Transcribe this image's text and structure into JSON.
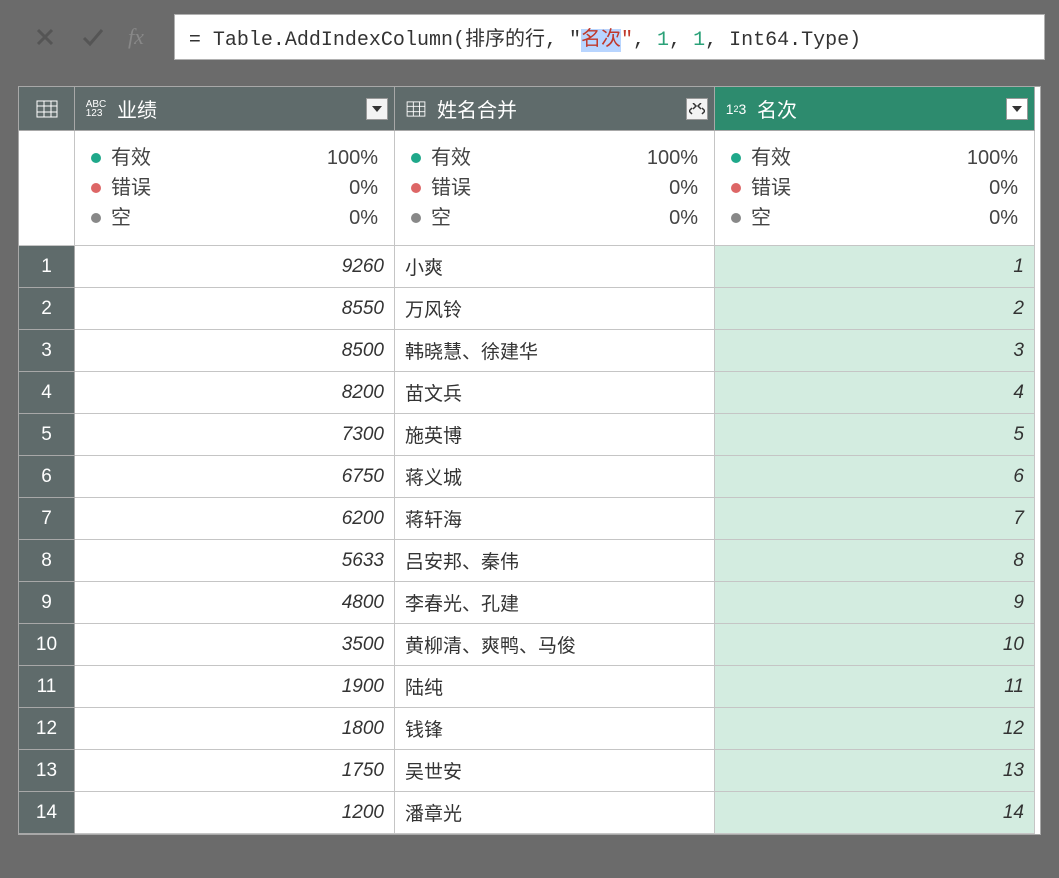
{
  "formula": {
    "prefix": "= ",
    "func": "Table.AddIndexColumn",
    "args_before_str": "排序的行, ",
    "str_val_quoted": "\"名次\"",
    "str_inner": "名次",
    "args_after_str1": ", ",
    "num1": "1",
    "args_sep": ", ",
    "num2": "1",
    "args_sep2": ", ",
    "type": "Int64.Type"
  },
  "columns": {
    "col1": {
      "name": "业绩",
      "type_label": "ABC 123"
    },
    "col2": {
      "name": "姓名合并",
      "type_label": "table"
    },
    "col3": {
      "name": "名次",
      "type_label": "1²3"
    }
  },
  "stats": {
    "valid_label": "有效",
    "error_label": "错误",
    "empty_label": "空",
    "col1": {
      "valid": "100%",
      "error": "0%",
      "empty": "0%"
    },
    "col2": {
      "valid": "100%",
      "error": "0%",
      "empty": "0%"
    },
    "col3": {
      "valid": "100%",
      "error": "0%",
      "empty": "0%"
    }
  },
  "rows": [
    {
      "n": "1",
      "yj": "9260",
      "xm": "小爽",
      "mc": "1"
    },
    {
      "n": "2",
      "yj": "8550",
      "xm": "万风铃",
      "mc": "2"
    },
    {
      "n": "3",
      "yj": "8500",
      "xm": "韩晓慧、徐建华",
      "mc": "3"
    },
    {
      "n": "4",
      "yj": "8200",
      "xm": "苗文兵",
      "mc": "4"
    },
    {
      "n": "5",
      "yj": "7300",
      "xm": "施英博",
      "mc": "5"
    },
    {
      "n": "6",
      "yj": "6750",
      "xm": "蒋义城",
      "mc": "6"
    },
    {
      "n": "7",
      "yj": "6200",
      "xm": "蒋轩海",
      "mc": "7"
    },
    {
      "n": "8",
      "yj": "5633",
      "xm": "吕安邦、秦伟",
      "mc": "8"
    },
    {
      "n": "9",
      "yj": "4800",
      "xm": "李春光、孔建",
      "mc": "9"
    },
    {
      "n": "10",
      "yj": "3500",
      "xm": "黄柳清、爽鸭、马俊",
      "mc": "10"
    },
    {
      "n": "11",
      "yj": "1900",
      "xm": "陆纯",
      "mc": "11"
    },
    {
      "n": "12",
      "yj": "1800",
      "xm": "钱锋",
      "mc": "12"
    },
    {
      "n": "13",
      "yj": "1750",
      "xm": "吴世安",
      "mc": "13"
    },
    {
      "n": "14",
      "yj": "1200",
      "xm": "潘章光",
      "mc": "14"
    }
  ]
}
